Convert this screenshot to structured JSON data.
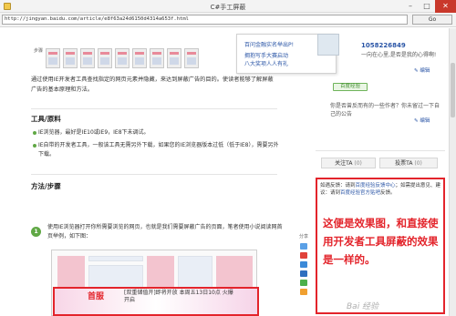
{
  "window": {
    "title": "C#手工屏蔽",
    "go_label": "Go"
  },
  "address": {
    "url": "http://jingyan.baidu.com/article/e8f63a24d6150d4314a653f.html"
  },
  "popup": {
    "line1": "百问金融实名举出P!",
    "line2": "拥抱写手大赛启动",
    "line3": "八大奖项人人有礼"
  },
  "article": {
    "steps_label": "步骤",
    "intro": "通过使用IE开发者工具查找指定的网页元素并隐藏，来达到屏蔽广告的目的。使读者能够了解屏蔽广告的基本原理和方法。",
    "tools_title": "工具/原料",
    "tools": [
      "IE浏览器，最好是IE10或IE9，IE8下未调试。",
      "IE自带的开发者工具，一般该工具无需另外下载，如果您的IE浏览器版本过低（低于IE8），需要另外下载。"
    ],
    "method_title": "方法/步骤",
    "step1_number": "1",
    "step1_text": "使用IE浏览器打开你所需要浏览的网页，也就是我们需要屏蔽广告的页面，笔者使用小说阅读网首页举例，如下图：",
    "banner_left": "首服",
    "banner_right": "[双重储值开]即将开放 本周五13日10点 火爆开启"
  },
  "share": {
    "label": "分享"
  },
  "sidebar": {
    "username": "1058226849",
    "motto": "一向在心里,是否是我的心得啊!",
    "edit_label": "编辑",
    "badge": "百度经验",
    "question": "你是否曾反而有的一些作者？你未留过一下自己的公告",
    "edit_label2": "编辑",
    "tab_follow": "关注TA",
    "tab_follow_count": "(0)",
    "tab_vote": "投票TA",
    "tab_vote_count": "(0)",
    "notice_text_a": "如遇反馈：请到",
    "notice_link_a": "百度经验反馈中心",
    "notice_text_b": "；如需提出意见、建议：请到",
    "notice_link_b": "百度经验官方贴吧",
    "notice_text_c": "反馈。",
    "annotation": "这便是效果图，和直接使用开发者工具屏蔽的效果是一样的。"
  },
  "watermark": "Bai 经验",
  "colors": {
    "accent_red": "#e3242b",
    "link_blue": "#2a55a6",
    "step_green": "#60a845"
  }
}
